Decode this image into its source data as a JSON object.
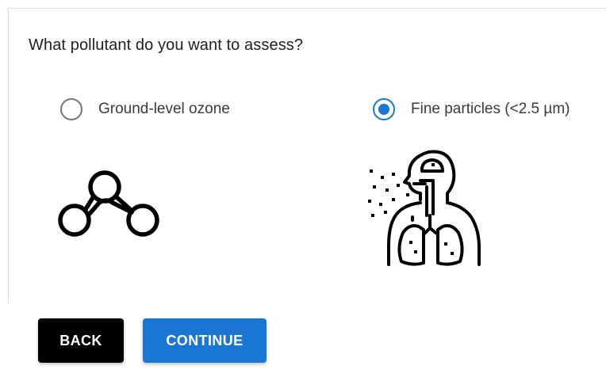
{
  "question": "What pollutant do you want to assess?",
  "options": [
    {
      "label": "Ground-level ozone",
      "selected": false,
      "icon": "ozone-molecule-icon"
    },
    {
      "label": "Fine particles (<2.5 µm)",
      "selected": true,
      "icon": "lungs-particles-icon"
    }
  ],
  "buttons": {
    "back": "BACK",
    "continue": "CONTINUE"
  },
  "colors": {
    "accent": "#1976d2",
    "back_button": "#000000",
    "radio_unselected": "#757575"
  }
}
